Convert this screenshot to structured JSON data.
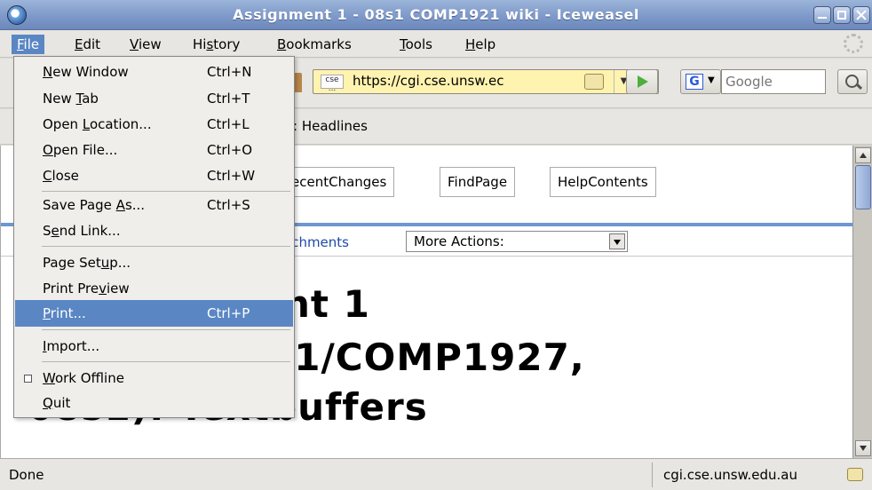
{
  "window": {
    "title": "Assignment 1 - 08s1 COMP1921 wiki - Iceweasel"
  },
  "menubar": {
    "items": [
      {
        "label": "File",
        "key": "F",
        "rest": "ile"
      },
      {
        "label": "Edit",
        "key": "E",
        "rest": "dit"
      },
      {
        "label": "View",
        "key": "V",
        "rest": "iew"
      },
      {
        "pre": "Hi",
        "key": "s",
        "rest": "tory"
      },
      {
        "label": "Bookmarks",
        "key": "B",
        "rest": "ookmarks"
      },
      {
        "label": "Tools",
        "key": "T",
        "rest": "ools"
      },
      {
        "label": "Help",
        "key": "H",
        "rest": "elp"
      }
    ]
  },
  "navbar": {
    "url_site_label": "cse ...",
    "url": "https://cgi.cse.unsw.ec",
    "search_engine_letter": "G",
    "search_placeholder": "Google"
  },
  "bookmarks": {
    "headlines": ": Headlines"
  },
  "content": {
    "tabs": [
      "ecentChanges",
      "FindPage",
      "HelpContents"
    ],
    "attachments_link": "achments",
    "more_actions": "More Actions:",
    "heading_lines": [
      "nt 1",
      "21/COMP1927,",
      "08s1): Textbuffers"
    ]
  },
  "filemenu": {
    "items": [
      {
        "pre": "",
        "key": "N",
        "post": "ew Window",
        "accel": "Ctrl+N"
      },
      {
        "pre": "New ",
        "key": "T",
        "post": "ab",
        "accel": "Ctrl+T"
      },
      {
        "pre": "Open ",
        "key": "L",
        "post": "ocation...",
        "accel": "Ctrl+L"
      },
      {
        "pre": "",
        "key": "O",
        "post": "pen File...",
        "accel": "Ctrl+O"
      },
      {
        "pre": "",
        "key": "C",
        "post": "lose",
        "accel": "Ctrl+W"
      },
      {
        "pre": "Save Page ",
        "key": "A",
        "post": "s...",
        "accel": "Ctrl+S"
      },
      {
        "pre": "S",
        "key": "e",
        "post": "nd Link...",
        "accel": ""
      },
      {
        "pre": "Page Set",
        "key": "u",
        "post": "p...",
        "accel": ""
      },
      {
        "pre": "Print Pre",
        "key": "v",
        "post": "iew",
        "accel": ""
      },
      {
        "pre": "",
        "key": "P",
        "post": "rint...",
        "accel": "Ctrl+P"
      },
      {
        "pre": "",
        "key": "I",
        "post": "mport...",
        "accel": ""
      },
      {
        "pre": "",
        "key": "W",
        "post": "ork Offline",
        "accel": ""
      },
      {
        "pre": "",
        "key": "Q",
        "post": "uit",
        "accel": ""
      }
    ]
  },
  "statusbar": {
    "text": "Done",
    "host": "cgi.cse.unsw.edu.au"
  }
}
